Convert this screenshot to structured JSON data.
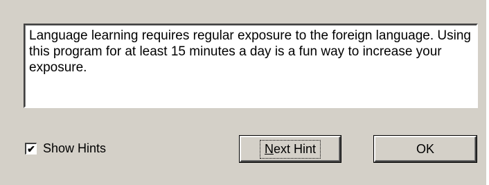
{
  "hint": {
    "text": "Language learning requires regular exposure to the foreign language. Using this program  for at least 15 minutes a day is a fun way to increase your exposure."
  },
  "show_hints": {
    "label": "Show Hints",
    "checked": true,
    "check_glyph": "✔"
  },
  "buttons": {
    "next_hint": {
      "mnemonic": "N",
      "rest": "ext Hint"
    },
    "ok": "OK"
  },
  "colors": {
    "dialog_bg": "#d4d0c8",
    "text_bg": "#ffffff"
  }
}
